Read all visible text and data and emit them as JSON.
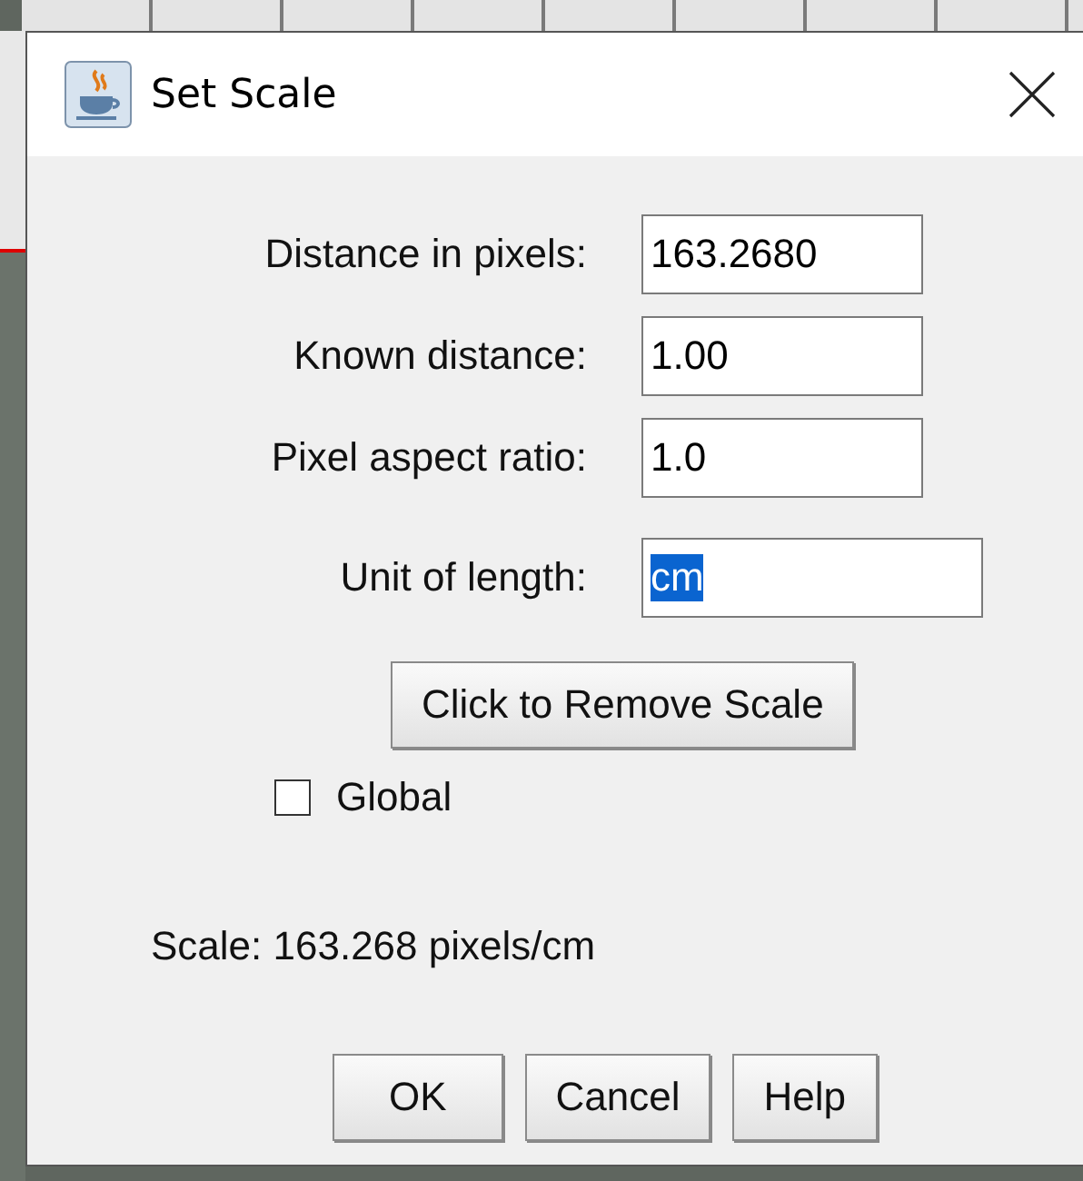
{
  "window": {
    "title": "Set Scale"
  },
  "fields": [
    {
      "label": "Distance in pixels:",
      "value": "163.2680",
      "text_selected": false,
      "kind": "short"
    },
    {
      "label": "Known distance:",
      "value": "1.00",
      "text_selected": false,
      "kind": "short"
    },
    {
      "label": "Pixel aspect ratio:",
      "value": "1.0",
      "text_selected": false,
      "kind": "short"
    },
    {
      "label": "Unit of length:",
      "value": "cm",
      "text_selected": true,
      "kind": "long"
    }
  ],
  "remove_button": "Click to Remove Scale",
  "global_checkbox": {
    "label": "Global",
    "checked": false
  },
  "scale_text": "Scale: 163.268 pixels/cm",
  "buttons": [
    "OK",
    "Cancel",
    "Help"
  ]
}
